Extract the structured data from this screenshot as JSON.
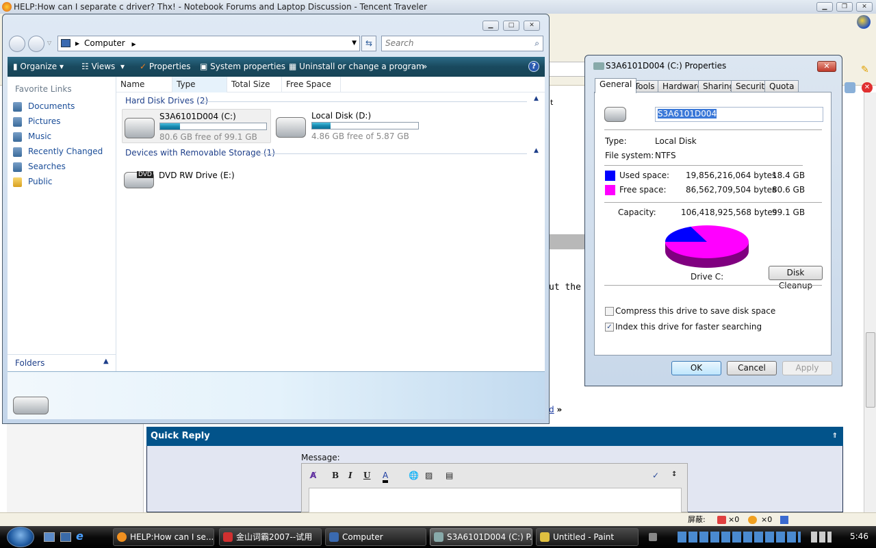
{
  "browser": {
    "title": "HELP:How can I separate c driver? Thx! - Notebook Forums and Laptop Discussion - Tencent Traveler",
    "snippets": {
      "t": "t",
      "text_fragment": "ut the s",
      "link_fragment": "d",
      "link_arrow": "»"
    },
    "quick_reply": {
      "title": "Quick Reply",
      "message_label": "Message:"
    },
    "editor_buttons": [
      "B",
      "I",
      "U",
      "A"
    ],
    "status": {
      "blocked_label": "屏蔽:",
      "count1": "×0",
      "count2": "×0"
    }
  },
  "explorer": {
    "address": {
      "root": "Computer"
    },
    "search_placeholder": "Search",
    "commands": {
      "organize": "Organize",
      "views": "Views",
      "properties": "Properties",
      "system_properties": "System properties",
      "uninstall": "Uninstall or change a program",
      "more": "»"
    },
    "favorite_links_title": "Favorite Links",
    "favorite_links": [
      "Documents",
      "Pictures",
      "Music",
      "Recently Changed",
      "Searches",
      "Public"
    ],
    "folders_label": "Folders",
    "columns": [
      "Name",
      "Type",
      "Total Size",
      "Free Space"
    ],
    "groups": {
      "hdd": "Hard Disk Drives (2)",
      "removable": "Devices with Removable Storage (1)"
    },
    "drives": [
      {
        "name": "S3A6101D004 (C:)",
        "free_text": "80.6 GB free of 99.1 GB",
        "used_fraction": 0.187
      },
      {
        "name": "Local Disk (D:)",
        "free_text": "4.86 GB free of 5.87 GB",
        "used_fraction": 0.172
      }
    ],
    "dvd": {
      "name": "DVD RW Drive (E:)",
      "badge": "DVD"
    }
  },
  "properties": {
    "title": "S3A6101D004 (C:) Properties",
    "tabs": [
      "General",
      "Tools",
      "Hardware",
      "Sharing",
      "Security",
      "Quota"
    ],
    "volume_label": "S3A6101D004",
    "type_label": "Type:",
    "type_value": "Local Disk",
    "fs_label": "File system:",
    "fs_value": "NTFS",
    "used": {
      "label": "Used space:",
      "bytes": "19,856,216,064 bytes",
      "size": "18.4 GB",
      "color": "#0000ff"
    },
    "free": {
      "label": "Free space:",
      "bytes": "86,562,709,504 bytes",
      "size": "80.6 GB",
      "color": "#ff00ff"
    },
    "capacity": {
      "label": "Capacity:",
      "bytes": "106,418,925,568 bytes",
      "size": "99.1 GB"
    },
    "used_fraction": 0.1866,
    "drive_caption": "Drive C:",
    "disk_cleanup": "Disk Cleanup",
    "compress_label": "Compress this drive to save disk space",
    "compress_checked": false,
    "index_label": "Index this drive for faster searching",
    "index_checked": true,
    "ok": "OK",
    "cancel": "Cancel",
    "apply": "Apply"
  },
  "taskbar": {
    "tasks": [
      "HELP:How can I se...",
      "金山词霸2007--试用",
      "Computer",
      "S3A6101D004 (C:) P...",
      "Untitled - Paint"
    ],
    "clock": "5:46"
  }
}
